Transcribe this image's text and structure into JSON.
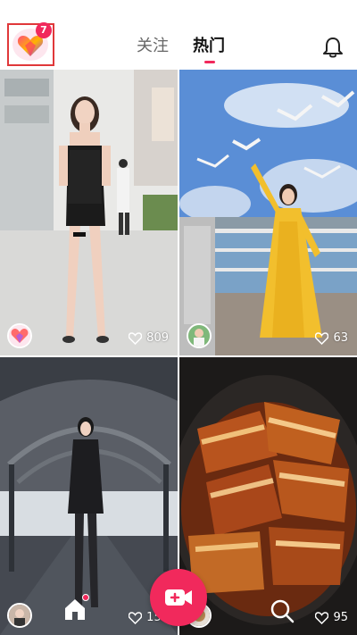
{
  "header": {
    "notification_count": "7",
    "tabs": [
      {
        "label": "关注",
        "active": false
      },
      {
        "label": "热门",
        "active": true
      }
    ]
  },
  "accent_color": "#f1295c",
  "feed": [
    {
      "likes": "809",
      "subject": "woman in black lace dress on street"
    },
    {
      "likes": "63",
      "subject": "woman in yellow dress with seagulls by the sea"
    },
    {
      "likes": "152",
      "subject": "woman in black suit under arched bridge"
    },
    {
      "likes": "95",
      "subject": "braised pork belly in clay pot"
    }
  ],
  "icons": {
    "app_logo": "heart-logo-icon",
    "notification": "bell-icon",
    "like": "heart-outline-icon",
    "home": "home-icon",
    "record": "video-camera-icon",
    "search": "search-icon"
  }
}
